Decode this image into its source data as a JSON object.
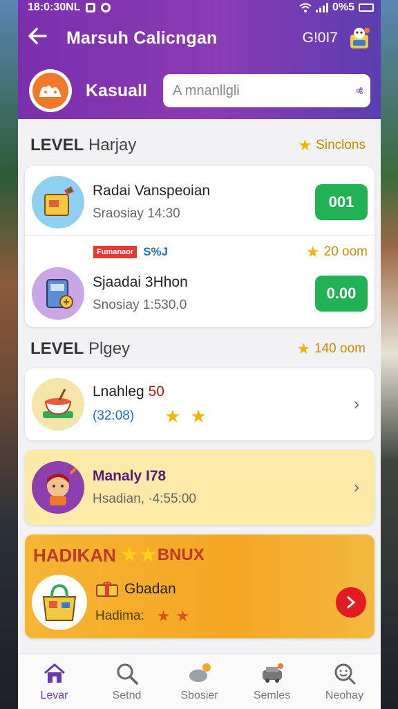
{
  "status_bar": {
    "time": "18:0:30NL",
    "battery": "0%5"
  },
  "header": {
    "title": "Marsuh Calicngan",
    "code": "G!0I7",
    "username": "Kasuall",
    "search_placeholder": "A mnanllgli"
  },
  "section1": {
    "title_bold": "LEVEL",
    "title_rest": " Harjay",
    "meta": "Sinclons",
    "items": [
      {
        "title": "Radai Vanspeoian",
        "sub": "Sraosiay 14:30",
        "value": "001"
      },
      {
        "tag_red": "Fumanaor",
        "tag_blue": "S%J",
        "points": "20 oom",
        "title": "Sjaadai 3Hhon",
        "sub": "Snosiay 1:530.0",
        "value": "0.00"
      }
    ]
  },
  "section2": {
    "title_bold": "LEVEL",
    "title_rest": " Plgey",
    "meta": "140 oom",
    "items": [
      {
        "title_a": "Lnahleg",
        "title_b": " 50",
        "sub": "(32:08)"
      },
      {
        "title": "Manaly I78",
        "sub": "Hsadian, ·4:55:00"
      }
    ]
  },
  "bonus": {
    "title": "HADIKAN",
    "title_b": "BNUX",
    "item_title": "Gbadan",
    "item_sub": "Hadima:"
  },
  "nav": [
    {
      "label": "Levar"
    },
    {
      "label": "Setnd"
    },
    {
      "label": "Sbosier"
    },
    {
      "label": "Semles"
    },
    {
      "label": "Neohay"
    }
  ],
  "colors": {
    "header": "#7b2fae",
    "accent_green": "#21b254",
    "nav_active": "#6a3aad",
    "bonus_orange": "#f5a623"
  }
}
